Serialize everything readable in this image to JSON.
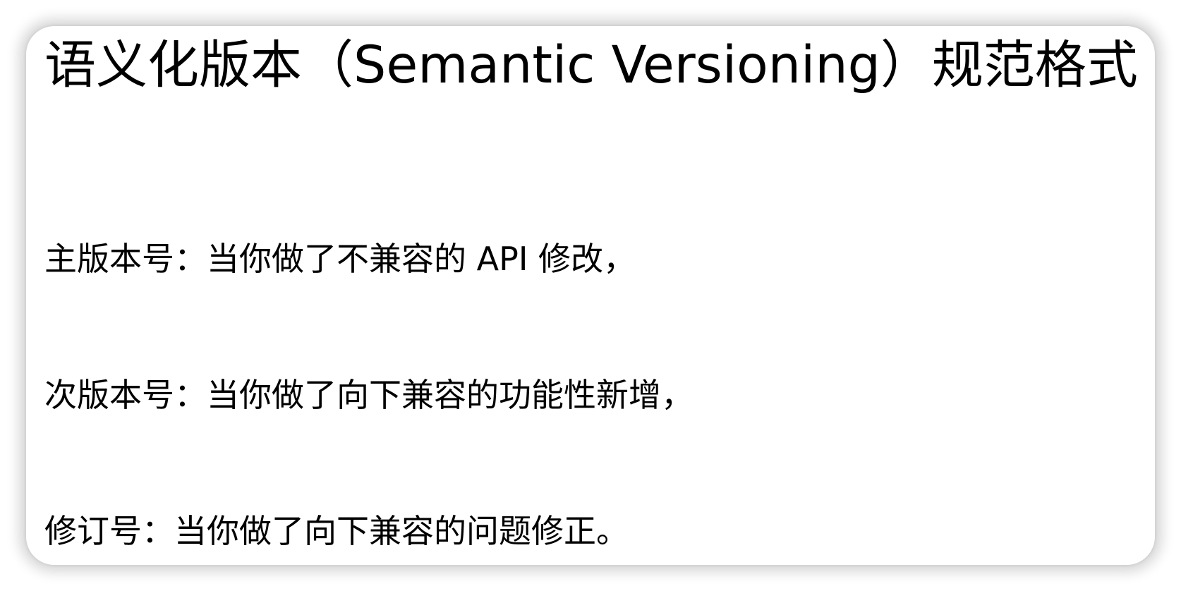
{
  "document": {
    "title": "语义化版本（Semantic Versioning）规范格式",
    "lines": [
      "主版本号：当你做了不兼容的 API 修改，",
      "次版本号：当你做了向下兼容的功能性新增，",
      "修订号：当你做了向下兼容的问题修正。"
    ]
  }
}
